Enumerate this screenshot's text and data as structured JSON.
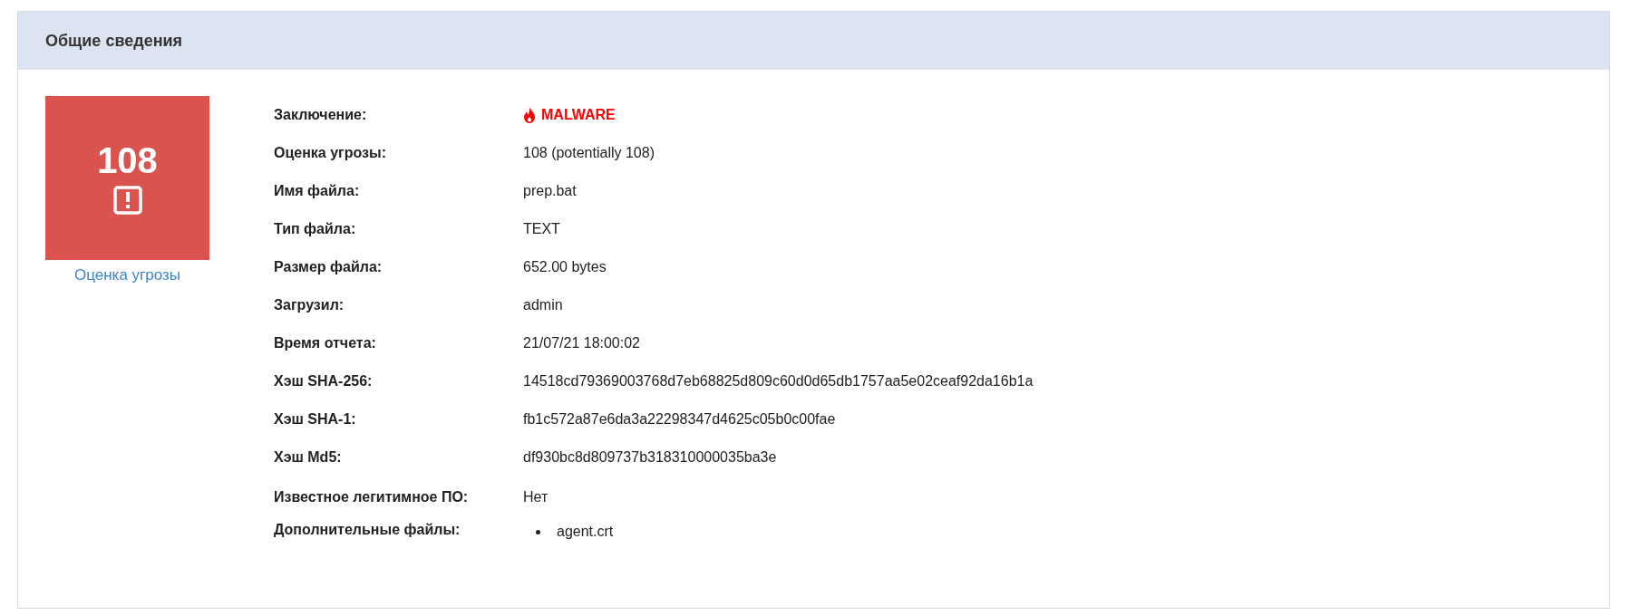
{
  "panel": {
    "title": "Общие сведения"
  },
  "score": {
    "value": "108",
    "caption": "Оценка угрозы"
  },
  "rows": [
    {
      "kind": "verdict",
      "label": "Заключение:",
      "value": "MALWARE"
    },
    {
      "kind": "text",
      "label": "Оценка угрозы:",
      "value": "108 (potentially 108)"
    },
    {
      "kind": "text",
      "label": "Имя файла:",
      "value": "prep.bat"
    },
    {
      "kind": "text",
      "label": "Тип файла:",
      "value": "TEXT"
    },
    {
      "kind": "text",
      "label": "Размер файла:",
      "value": "652.00 bytes"
    },
    {
      "kind": "text",
      "label": "Загрузил:",
      "value": "admin"
    },
    {
      "kind": "text",
      "label": "Время отчета:",
      "value": "21/07/21 18:00:02"
    },
    {
      "kind": "text",
      "label": "Хэш SHA-256:",
      "value": "14518cd79369003768d7eb68825d809c60d0d65db1757aa5e02ceaf92da16b1a"
    },
    {
      "kind": "text",
      "label": "Хэш SHA-1:",
      "value": "fb1c572a87e6da3a22298347d4625c05b0c00fae"
    },
    {
      "kind": "text",
      "label": "Хэш Md5:",
      "value": "df930bc8d809737b318310000035ba3e"
    }
  ],
  "extra": {
    "known_label": "Известное легитимное ПО:",
    "known_value": "Нет",
    "files_label": "Дополнительные файлы:",
    "files": [
      "agent.crt"
    ]
  }
}
